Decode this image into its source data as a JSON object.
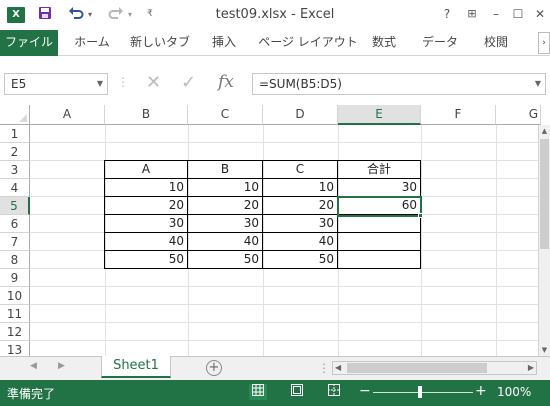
{
  "window": {
    "title": "test09.xlsx - Excel",
    "logo": "X",
    "help_btn": "?",
    "restore_btn": "⊞",
    "minimize_btn": "–",
    "maximize_btn": "☐",
    "close_btn": "✕"
  },
  "ribbon": {
    "tabs": [
      "ファイル",
      "ホーム",
      "新しいタブ",
      "挿入",
      "ページ レイアウト",
      "数式",
      "データ",
      "校閲"
    ]
  },
  "formula_bar": {
    "name_box": "E5",
    "formula": "=SUM(B5:D5)",
    "fx_label": "fx"
  },
  "grid": {
    "columns": [
      "A",
      "B",
      "C",
      "D",
      "E",
      "F",
      "G"
    ],
    "rows": [
      "1",
      "2",
      "3",
      "4",
      "5",
      "6",
      "7",
      "8",
      "9",
      "10",
      "11",
      "12",
      "13"
    ],
    "selected_column": "E",
    "selected_row": "5",
    "table": {
      "header": [
        "A",
        "B",
        "C",
        "合計"
      ],
      "rows": [
        [
          "10",
          "10",
          "10",
          "30"
        ],
        [
          "20",
          "20",
          "20",
          "60"
        ],
        [
          "30",
          "30",
          "30",
          ""
        ],
        [
          "40",
          "40",
          "40",
          ""
        ],
        [
          "50",
          "50",
          "50",
          ""
        ]
      ]
    }
  },
  "sheets": {
    "active": "Sheet1",
    "add_label": "+"
  },
  "status": {
    "text": "準備完了",
    "zoom": "100%",
    "zoom_minus": "−",
    "zoom_plus": "+"
  },
  "colors": {
    "accent": "#217346"
  }
}
